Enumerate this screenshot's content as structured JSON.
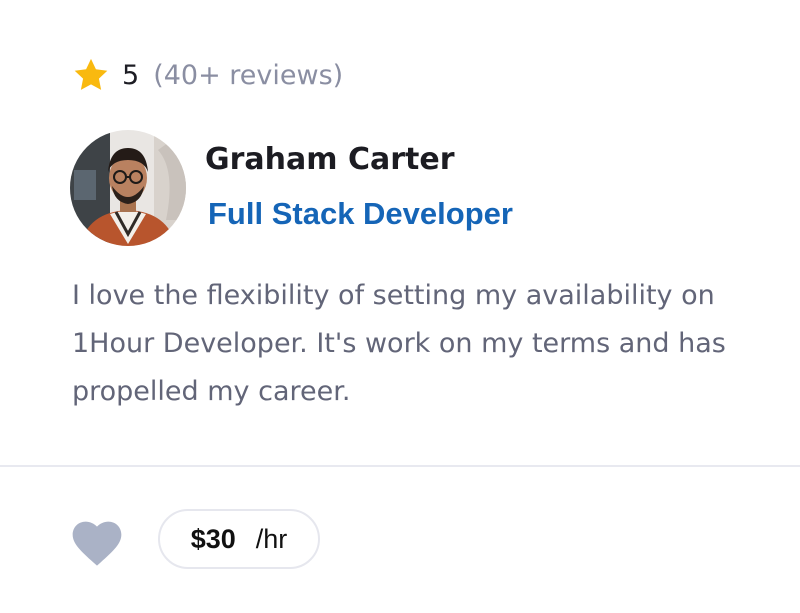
{
  "rating": {
    "icon": "star-icon",
    "star_color": "#f9b90f",
    "value": "5",
    "reviews_label": "(40+ reviews)"
  },
  "profile": {
    "name": "Graham Carter",
    "role": "Full Stack Developer",
    "role_color": "#1565b7"
  },
  "testimonial": {
    "text": "I love the flexibility of setting my availability on 1Hour Developer. It's work on my terms and has propelled my career."
  },
  "footer": {
    "favorite_icon": "heart-icon",
    "favorite_color": "#aab2c6",
    "price": "$30",
    "price_unit": "/hr"
  }
}
